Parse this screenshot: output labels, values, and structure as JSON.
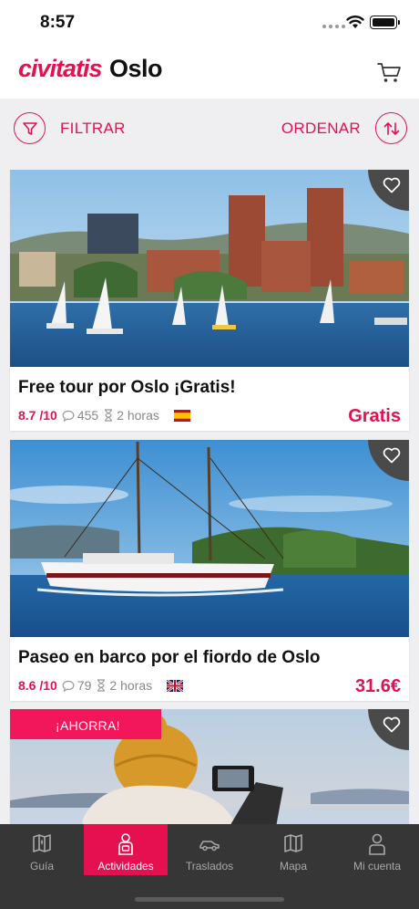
{
  "status": {
    "time": "8:57"
  },
  "header": {
    "brand": "civitatis",
    "city": "Oslo",
    "cart_icon": "cart-icon"
  },
  "filterbar": {
    "filter_label": "FILTRAR",
    "sort_label": "ORDENAR"
  },
  "colors": {
    "brand": "#e5104f",
    "tabbar_bg": "#363636",
    "page_bg": "#efeff1"
  },
  "cards": [
    {
      "title": "Free tour por Oslo ¡Gratis!",
      "rating": "8.7 /10",
      "reviews": "455",
      "duration": "2 horas",
      "language_flag": "spain-flag",
      "price": "Gratis",
      "image": "oslo-city-hall-harbor"
    },
    {
      "title": "Paseo en barco por el fiordo de Oslo",
      "rating": "8.6 /10",
      "reviews": "79",
      "duration": "2 horas",
      "language_flag": "uk-flag",
      "price": "31.6€",
      "image": "sailing-ship-fjord"
    },
    {
      "badge": "¡AHORRA!",
      "image": "person-photographing-fjord"
    }
  ],
  "tabbar": {
    "items": [
      {
        "label": "Guía",
        "icon": "map-book-icon",
        "active": false
      },
      {
        "label": "Actividades",
        "icon": "activities-person-icon",
        "active": true
      },
      {
        "label": "Traslados",
        "icon": "car-icon",
        "active": false
      },
      {
        "label": "Mapa",
        "icon": "map-icon",
        "active": false
      },
      {
        "label": "Mi cuenta",
        "icon": "user-icon",
        "active": false
      }
    ]
  }
}
